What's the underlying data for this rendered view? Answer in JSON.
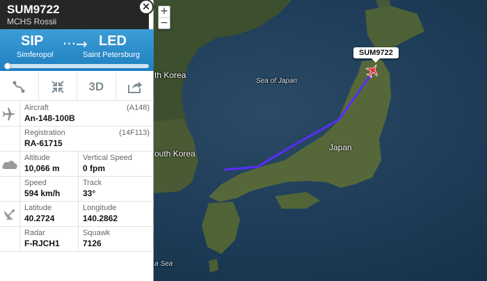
{
  "header": {
    "callsign": "SUM9722",
    "airline": "MCHS Rossii",
    "close_icon": "×"
  },
  "route": {
    "from_code": "SIP",
    "from_city": "Simferopol",
    "to_code": "LED",
    "to_city": "Saint Petersburg",
    "arrow": "···→",
    "progress": 0.02
  },
  "toolbar": {
    "view_3d": "3D"
  },
  "info": {
    "aircraft_label": "Aircraft",
    "aircraft_value": "An-148-100B",
    "aircraft_code": "(A148)",
    "registration_label": "Registration",
    "registration_value": "RA-61715",
    "registration_code": "(14F113)",
    "altitude_label": "Altitude",
    "altitude_value": "10,066 m",
    "vspeed_label": "Vertical Speed",
    "vspeed_value": "0 fpm",
    "speed_label": "Speed",
    "speed_value": "594 km/h",
    "track_label": "Track",
    "track_value": "33°",
    "latitude_label": "Latitude",
    "latitude_value": "40.2724",
    "longitude_label": "Longitude",
    "longitude_value": "140.2862",
    "radar_label": "Radar",
    "radar_value": "F-RJCH1",
    "squawk_label": "Squawk",
    "squawk_value": "7126"
  },
  "map": {
    "zoom_in": "+",
    "zoom_out": "−",
    "labels": {
      "north_korea": "th Korea",
      "south_korea": "outh Korea",
      "sea_of_japan": "Sea of Japan",
      "japan": "Japan",
      "sea_bottom": "a Sea"
    },
    "callout": "SUM9722",
    "track_color": "#5a2dff"
  }
}
